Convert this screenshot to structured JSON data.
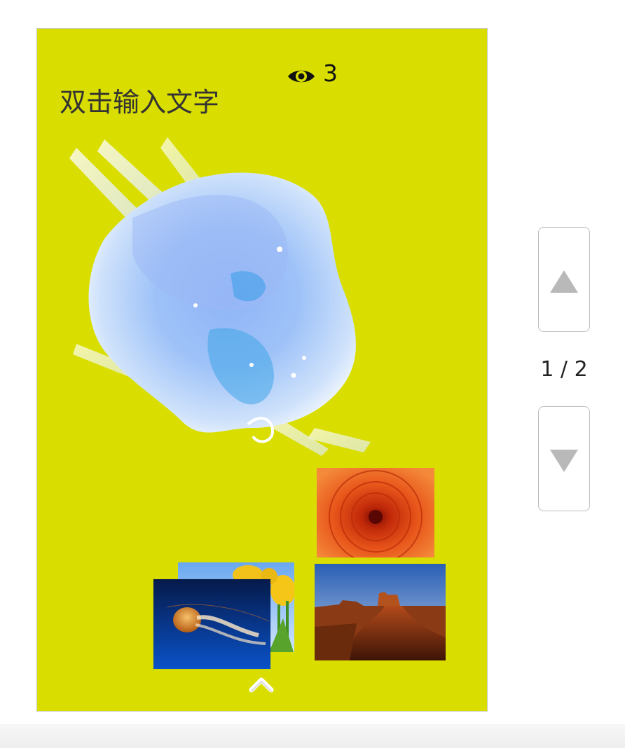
{
  "page": {
    "title": "双击输入文字",
    "views": "3",
    "background_color": "#d9de00"
  },
  "icons": {
    "views": "eye-icon",
    "up": "chevron-up-icon",
    "prev_page": "triangle-up-icon",
    "next_page": "triangle-down-icon"
  },
  "pager": {
    "indicator": "1 / 2"
  }
}
